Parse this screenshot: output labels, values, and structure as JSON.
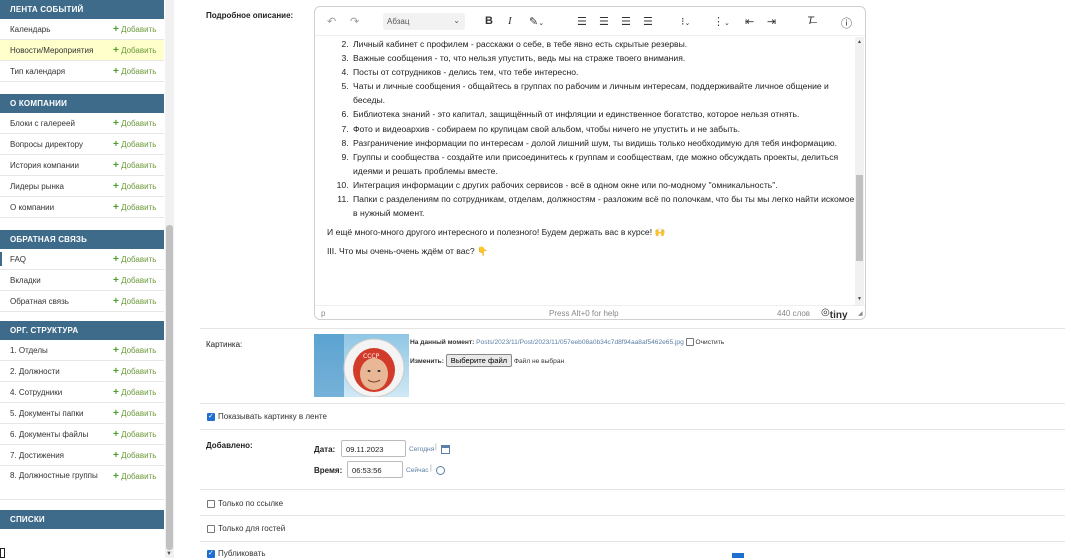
{
  "sidebar": {
    "add_label": "Добавить",
    "sections": [
      {
        "title": "ЛЕНТА СОБЫТИЙ",
        "items": [
          {
            "label": "Календарь"
          },
          {
            "label": "Новости/Мероприятия"
          },
          {
            "label": "Тип календаря"
          }
        ]
      },
      {
        "title": "О КОМПАНИИ",
        "items": [
          {
            "label": "Блоки с галереей"
          },
          {
            "label": "Вопросы директору"
          },
          {
            "label": "История компании"
          },
          {
            "label": "Лидеры рынка"
          },
          {
            "label": "О компании"
          }
        ]
      },
      {
        "title": "ОБРАТНАЯ СВЯЗЬ",
        "items": [
          {
            "label": "FAQ"
          },
          {
            "label": "Вкладки"
          },
          {
            "label": "Обратная связь"
          }
        ]
      },
      {
        "title": "ОРГ. СТРУКТУРА",
        "items": [
          {
            "label": "1. Отделы"
          },
          {
            "label": "2. Должности"
          },
          {
            "label": "4. Сотрудники"
          },
          {
            "label": "5. Документы папки"
          },
          {
            "label": "6. Документы файлы"
          },
          {
            "label": "7. Достижения"
          },
          {
            "label": "8. Должностные группы"
          }
        ]
      },
      {
        "title": "СПИСКИ",
        "items": []
      }
    ]
  },
  "form": {
    "description_label": "Подробное описание:",
    "editor": {
      "block_format": "Абзац",
      "list_items": [
        "Личный кабинет с профилем - расскажи о себе, в тебе явно есть скрытые резервы.",
        "Важные сообщения - то, что нельзя упустить, ведь мы на страже твоего внимания.",
        "Посты от сотрудников - делись тем, что тебе интересно.",
        "Чаты и личные сообщения - общайтесь в группах по рабочим и личным интересам, поддерживайте личное общение и беседы.",
        "Библиотека знаний - это капитал, защищённый от инфляции и единственное богатство, которое нельзя отнять.",
        "Фото и видеоархив - собираем по крупицам свой альбом, чтобы ничего не упустить и не забыть.",
        "Разграничение информации по интересам - долой лишний шум, ты видишь только необходимую для тебя информацию.",
        "Группы и сообщества - создайте или присоединитесь к группам и сообществам, где можно обсуждать проекты, делиться идеями и решать проблемы вместе.",
        "Интеграция информации с других рабочих сервисов - всё в одном окне или по-модному \"омникальность\".",
        "Папки с разделениям по сотрудникам, отделам, должностям - разложим всё по полочкам, что бы ты мы легко найти искомое в нужный момент."
      ],
      "paragraph_1": "И ещё много-много другого интересного и полезного! Будем держать вас в курсе! 🙌",
      "paragraph_2": "III. Что мы очень-очень ждём от вас? 👇",
      "status_path": "p",
      "status_help": "Press Alt+0 for help",
      "word_count": "440 слов",
      "brand": "tiny"
    },
    "picture_label": "Картинка:",
    "current_label": "На данный момент:",
    "current_file": "Posts/2023/11/Post/2023/11/057eeb08a0b34c7d8f94aa8af5462e65.jpg",
    "clear_label": "Очистить",
    "change_label": "Изменить:",
    "choose_file_button": "Выберите файл",
    "no_file_text": "Файл не выбран",
    "show_in_feed_label": "Показывать картинку в ленте",
    "added_label": "Добавлено:",
    "date_label": "Дата:",
    "date_value": "09.11.2023",
    "today_link": "Сегодня",
    "time_label": "Время:",
    "time_value": "06:53:56",
    "now_link": "Сейчас",
    "only_link_label": "Только по ссылке",
    "only_guests_label": "Только для гостей",
    "publish_label": "Публиковать"
  },
  "colors": {
    "section_header": "#3e6b8a",
    "add_green": "#49a02c",
    "highlight": "#ffffcc",
    "link_blue": "#5b7fa6"
  }
}
